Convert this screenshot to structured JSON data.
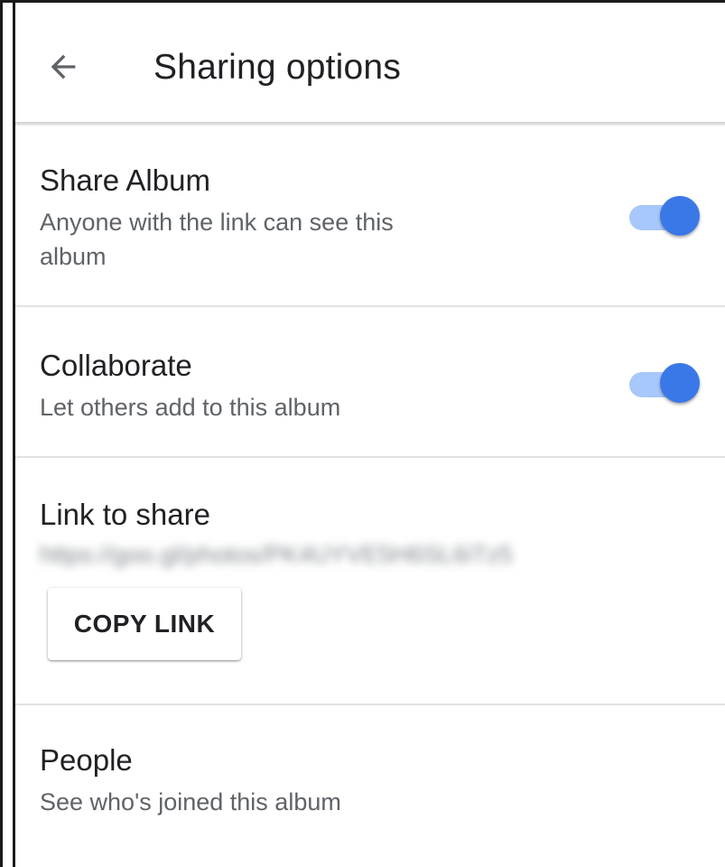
{
  "header": {
    "title": "Sharing options",
    "back_icon": "arrow-left-icon"
  },
  "share_album": {
    "title": "Share Album",
    "subtitle_line1": "Anyone with the link can see this",
    "subtitle_line2": "album",
    "enabled": true
  },
  "collaborate": {
    "title": "Collaborate",
    "subtitle": "Let others add to this album",
    "enabled": true
  },
  "link_to_share": {
    "title": "Link to share",
    "url": "https://goo.gl/photos/PK4UYVE5H6SL6iTz5",
    "copy_button_label": "COPY LINK"
  },
  "people": {
    "title": "People",
    "subtitle": "See who's joined this album"
  },
  "colors": {
    "accent": "#3b78e7",
    "track": "#a8c7fa",
    "text_primary": "#202124",
    "text_secondary": "#5f6368"
  }
}
